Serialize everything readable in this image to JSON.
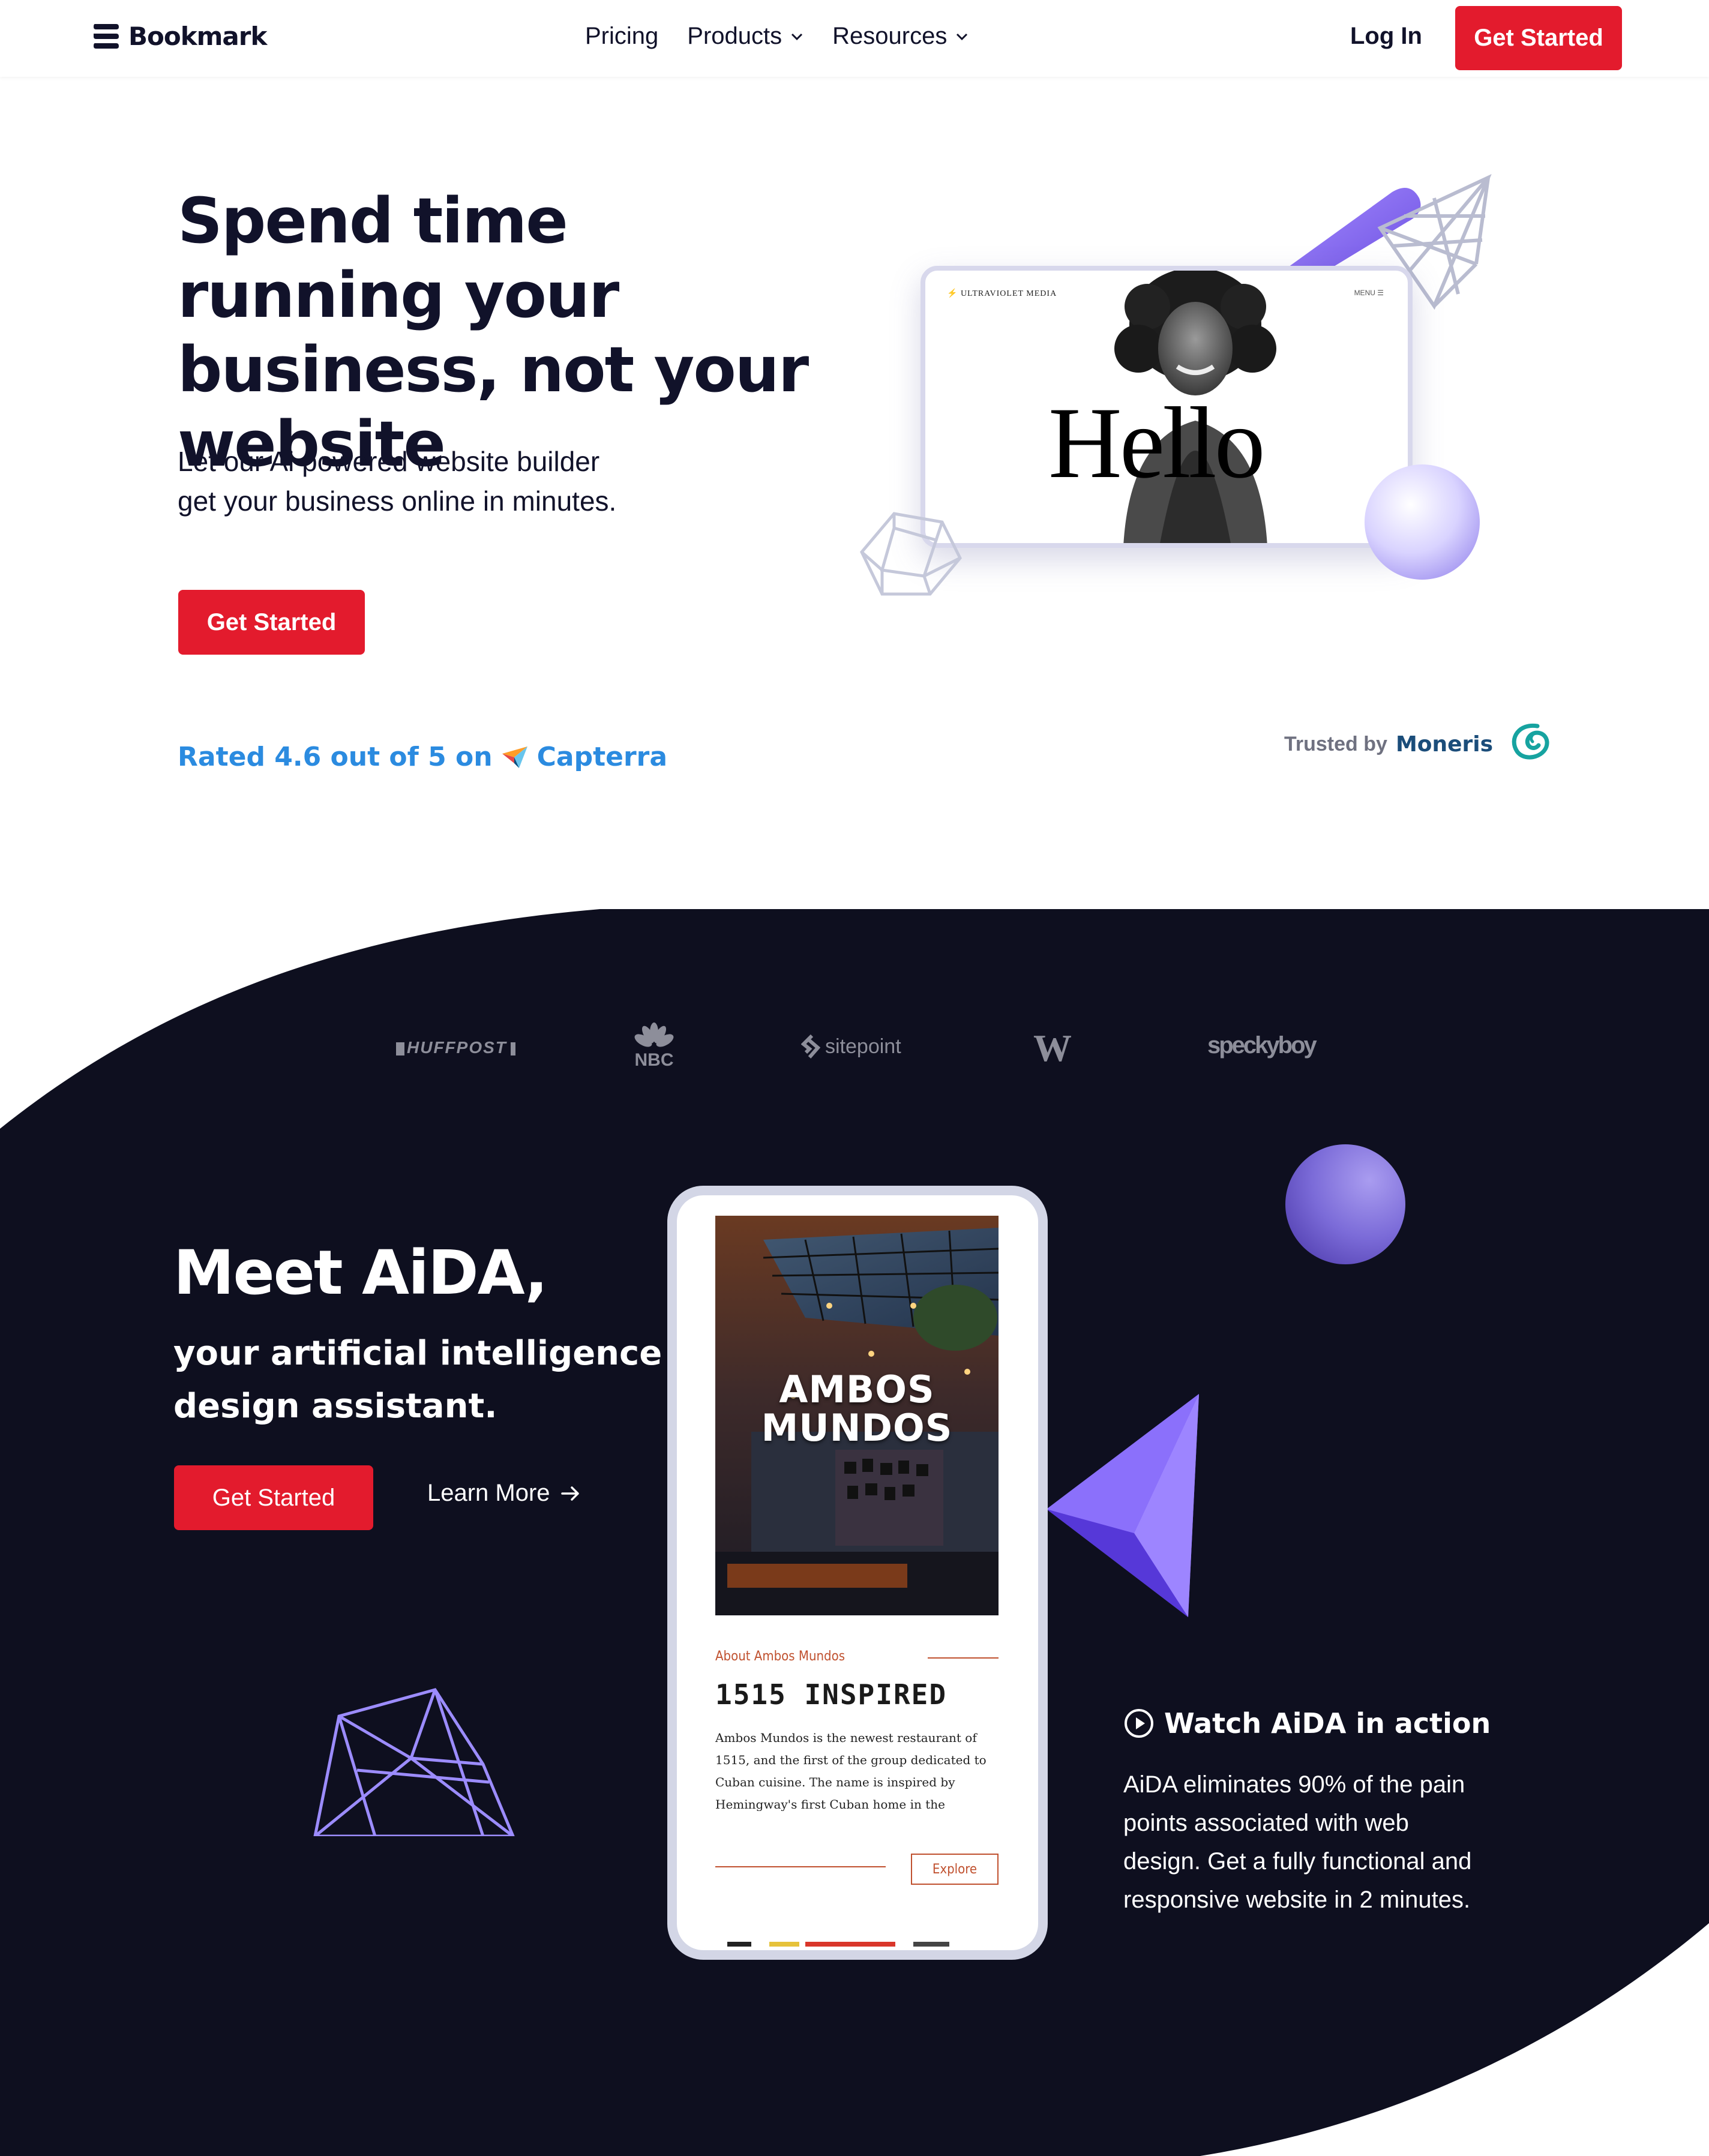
{
  "nav": {
    "brand": "Bookmark",
    "links": [
      {
        "label": "Pricing",
        "has_dropdown": false
      },
      {
        "label": "Products",
        "has_dropdown": true
      },
      {
        "label": "Resources",
        "has_dropdown": true
      }
    ],
    "login": "Log In",
    "cta": "Get Started"
  },
  "hero": {
    "title": "Spend time running your business, not your website",
    "subtitle_line1": "Let our Ai powered website builder",
    "subtitle_line2": "get your business online in minutes.",
    "cta": "Get Started",
    "rating_text": "Rated 4.6 out of 5 on",
    "rating_brand": "Capterra",
    "trusted_label": "Trusted by",
    "trusted_brand": "Moneris",
    "mockup": {
      "brand": "ULTRAVIOLET MEDIA",
      "menu": "MENU",
      "headline": "Hello"
    }
  },
  "press_logos": [
    "HUFFPOST",
    "NBC",
    "sitepoint",
    "W",
    "speckyboy"
  ],
  "aida": {
    "title": "Meet AiDA,",
    "subtitle": "your artificial intelligence design assistant.",
    "cta": "Get Started",
    "learn_more": "Learn More",
    "watch_label": "Watch AiDA in action",
    "description": "AiDA eliminates 90% of the pain points associated with web design. Get a fully functional and responsive website in 2 minutes."
  },
  "phone": {
    "hero_line1": "AMBOS",
    "hero_line2": "MUNDOS",
    "about": "About Ambos Mundos",
    "heading": "1515 INSPIRED",
    "body": "Ambos Mundos is the newest restaurant of 1515, and the first of the group dedicated to Cuban cuisine. The name is inspired by Hemingway's first Cuban home in the",
    "button": "Explore"
  },
  "colors": {
    "brand_red": "#e31b2d",
    "navy": "#11122a",
    "link_blue": "#2b8be0",
    "accent_purple": "#8a6cf0",
    "dark_bg": "#0e0f1f"
  }
}
